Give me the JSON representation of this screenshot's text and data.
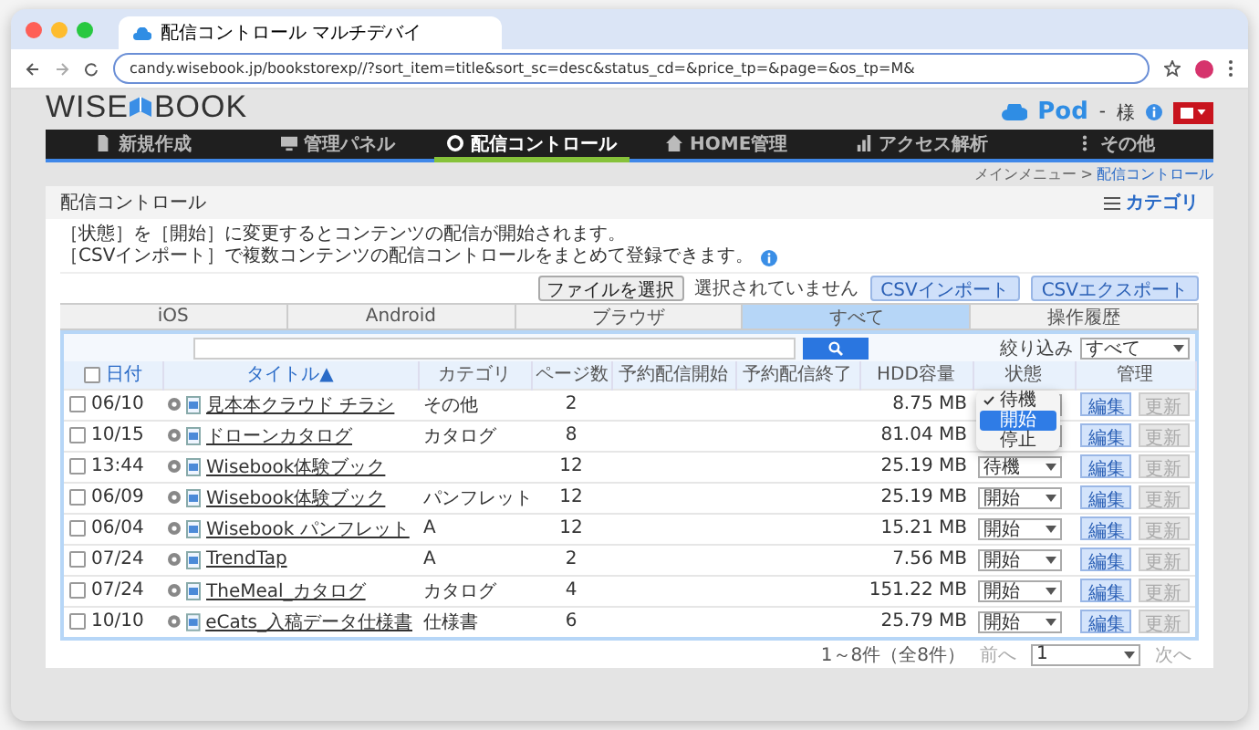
{
  "browser": {
    "tab_title": "配信コントロール マルチデバイ",
    "url": "candy.wisebook.jp/bookstorexp//?sort_item=title&sort_sc=desc&status_cd=&price_tp=&page=&os_tp=M&"
  },
  "header": {
    "logo_left": "WISE",
    "logo_right": "BOOK",
    "pod_logo": "Pod",
    "user_dash": "-",
    "user_suffix": "様"
  },
  "nav": [
    {
      "label": "新規作成",
      "selected": false
    },
    {
      "label": "管理パネル",
      "selected": false
    },
    {
      "label": "配信コントロール",
      "selected": true
    },
    {
      "label": "HOME管理",
      "selected": false
    },
    {
      "label": "アクセス解析",
      "selected": false
    },
    {
      "label": "その他",
      "selected": false
    }
  ],
  "breadcrumb": {
    "parent": "メインメニュー >",
    "current": "配信コントロール"
  },
  "panel": {
    "title": "配信コントロール",
    "category_link": "カテゴリ",
    "notes": [
      "［状態］を［開始］に変更するとコンテンツの配信が開始されます。",
      "［CSVインポート］で複数コンテンツの配信コントロールをまとめて登録できます。"
    ],
    "file_button": "ファイルを選択",
    "file_status": "選択されていません",
    "csv_import": "CSVインポート",
    "csv_export": "CSVエクスポート"
  },
  "tabs": [
    {
      "label": "iOS",
      "selected": false
    },
    {
      "label": "Android",
      "selected": false
    },
    {
      "label": "ブラウザ",
      "selected": false
    },
    {
      "label": "すべて",
      "selected": true
    },
    {
      "label": "操作履歴",
      "selected": false
    }
  ],
  "filter": {
    "label": "絞り込み",
    "value": "すべて"
  },
  "table": {
    "select_all_checked": false,
    "columns": [
      "日付",
      "タイトル▲",
      "カテゴリ",
      "ページ数",
      "予約配信開始",
      "予約配信終了",
      "HDD容量",
      "状態",
      "管理"
    ],
    "rows": [
      {
        "checked": false,
        "date": "06/10",
        "title": "見本本クラウド チラシ",
        "category": "その他",
        "pages": "2",
        "size": "8.75 MB",
        "edit": "編集",
        "update": "更新"
      },
      {
        "checked": false,
        "date": "10/15",
        "title": "ドローンカタログ",
        "category": "カタログ",
        "pages": "8",
        "size": "81.04 MB",
        "edit": "編集",
        "update": "更新"
      },
      {
        "checked": false,
        "date": "13:44",
        "title": "Wisebook体験ブック",
        "category": "",
        "pages": "12",
        "size": "25.19 MB",
        "status": "待機",
        "edit": "編集",
        "update": "更新"
      },
      {
        "checked": false,
        "date": "06/09",
        "title": "Wisebook体験ブック",
        "category": "パンフレット",
        "pages": "12",
        "size": "25.19 MB",
        "status": "開始",
        "edit": "編集",
        "update": "更新"
      },
      {
        "checked": false,
        "date": "06/04",
        "title": "Wisebook パンフレット",
        "category": "A",
        "pages": "12",
        "size": "15.21 MB",
        "status": "開始",
        "edit": "編集",
        "update": "更新"
      },
      {
        "checked": false,
        "date": "07/24",
        "title": "TrendTap",
        "category": "A",
        "pages": "2",
        "size": "7.56 MB",
        "status": "開始",
        "edit": "編集",
        "update": "更新"
      },
      {
        "checked": false,
        "date": "07/24",
        "title": "TheMeal_カタログ",
        "category": "カタログ",
        "pages": "4",
        "size": "151.22 MB",
        "status": "開始",
        "edit": "編集",
        "update": "更新"
      },
      {
        "checked": false,
        "date": "10/10",
        "title": "eCats_入稿データ仕様書",
        "category": "仕様書",
        "pages": "6",
        "size": "25.79 MB",
        "status": "開始",
        "edit": "編集",
        "update": "更新"
      }
    ]
  },
  "status_menu": [
    {
      "label": "待機",
      "checked": true,
      "selected": false
    },
    {
      "label": "開始",
      "checked": false,
      "selected": true
    },
    {
      "label": "停止",
      "checked": false,
      "selected": false
    }
  ],
  "pagination": {
    "summary": "1～8件（全8件）",
    "prev": "前へ",
    "page": "1",
    "next": "次へ"
  }
}
